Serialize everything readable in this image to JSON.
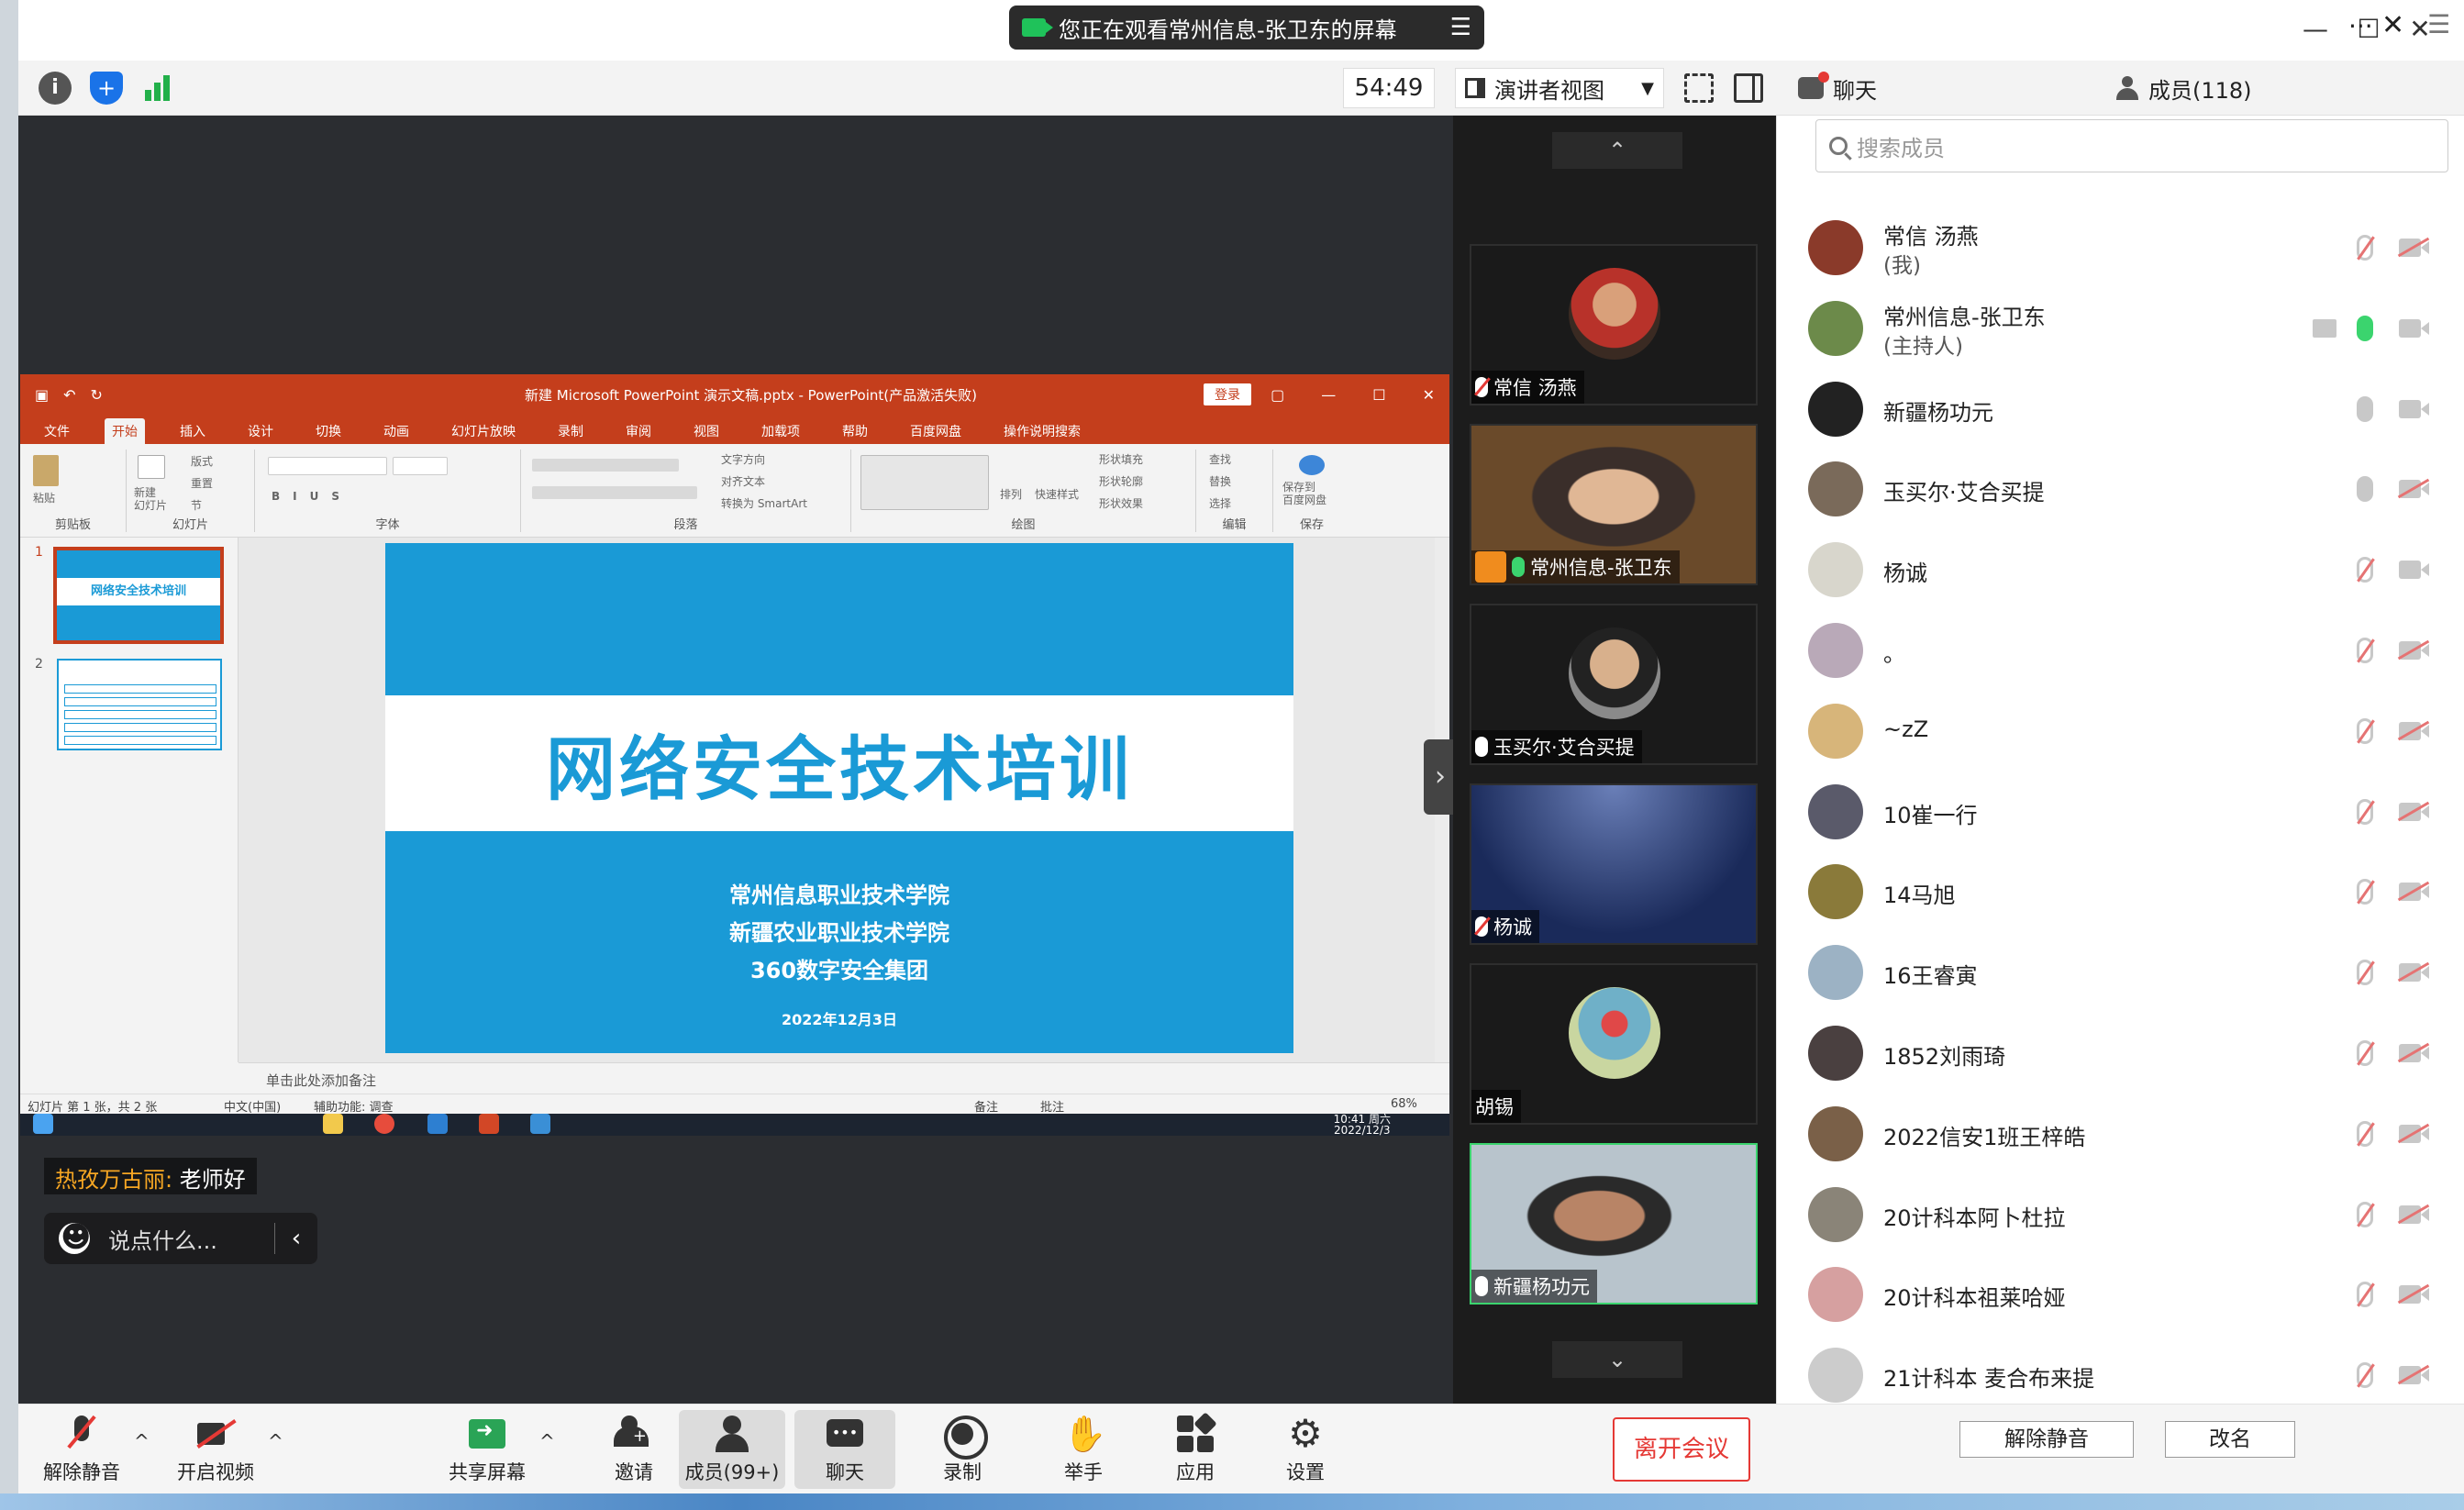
{
  "banner": {
    "text": "您正在观看常州信息-张卫东的屏幕",
    "menu_icon": "menu-icon"
  },
  "window_controls": {
    "minimize": "—",
    "maximize": "☐",
    "close": "✕"
  },
  "toolbar": {
    "timer": "54:49",
    "view_mode": "演讲者视图"
  },
  "ppt": {
    "doc_title": "新建 Microsoft PowerPoint 演示文稿.pptx - PowerPoint(产品激活失败)",
    "login": "登录",
    "tabs": [
      "文件",
      "开始",
      "插入",
      "设计",
      "切换",
      "动画",
      "幻灯片放映",
      "录制",
      "审阅",
      "视图",
      "加载项",
      "帮助",
      "百度网盘",
      "操作说明搜索"
    ],
    "ribbon_groups": [
      "剪贴板",
      "幻灯片",
      "字体",
      "段落",
      "绘图",
      "编辑",
      "保存"
    ],
    "ribbon_labels": {
      "paste": "粘贴",
      "new_slide": "新建\n幻灯片",
      "layout": "版式",
      "reset": "重置",
      "section": "节",
      "text_dir": "文字方向",
      "align_text": "对齐文本",
      "smartart": "转换为 SmartArt",
      "arrange": "排列",
      "quick_style": "快速样式",
      "shape_fill": "形状填充",
      "shape_outline": "形状轮廓",
      "shape_effect": "形状效果",
      "find": "查找",
      "replace": "替换",
      "select": "选择",
      "save_baidu": "保存到\n百度网盘"
    },
    "thumb1_title": "网络安全技术培训",
    "thumb_numbers": [
      "1",
      "2"
    ],
    "slide": {
      "title": "网络安全技术培训",
      "orgs": [
        "常州信息职业技术学院",
        "新疆农业职业技术学院",
        "360数字安全集团"
      ],
      "date": "2022年12月3日"
    },
    "notes_placeholder": "单击此处添加备注",
    "status": {
      "slide_count": "幻灯片 第 1 张，共 2 张",
      "language": "中文(中国)",
      "accessibility": "辅助功能: 调查",
      "notes": "备注",
      "comments": "批注",
      "zoom": "68%"
    },
    "clock": {
      "time": "10:41 周六",
      "date": "2022/12/3"
    }
  },
  "chat_overlay": {
    "sender": "热孜万古丽:",
    "message": "老师好",
    "input_placeholder": "说点什么...",
    "collapse": "‹"
  },
  "video_tiles": [
    {
      "name": "常信 汤燕",
      "mic": "muted"
    },
    {
      "name": "常州信息-张卫东",
      "mic": "active"
    },
    {
      "name": "玉买尔·艾合买提",
      "mic": "on"
    },
    {
      "name": "杨诚",
      "mic": "muted"
    },
    {
      "name": "胡锡",
      "mic": "none"
    },
    {
      "name": "新疆杨功元",
      "mic": "on"
    }
  ],
  "panel": {
    "chat_tab": "聊天",
    "members_tab": "成员(118)",
    "more": "···",
    "close": "✕",
    "search_placeholder": "搜索成员",
    "members": [
      {
        "name": "常信 汤燕",
        "sub": "(我)",
        "mic": "muted",
        "cam": "muted",
        "color": "#8a3a2a"
      },
      {
        "name": "常州信息-张卫东",
        "sub": "(主持人)",
        "mic": "green",
        "cam": "on",
        "share": true,
        "color": "#6c8a4a"
      },
      {
        "name": "新疆杨功元",
        "sub": "",
        "mic": "on",
        "cam": "on",
        "color": "#222222"
      },
      {
        "name": "玉买尔·艾合买提",
        "sub": "",
        "mic": "on",
        "cam": "muted",
        "color": "#7a6a5a"
      },
      {
        "name": "杨诚",
        "sub": "",
        "mic": "muted",
        "cam": "on",
        "color": "#d8d6cc"
      },
      {
        "name": "。",
        "sub": "",
        "mic": "muted",
        "cam": "muted",
        "color": "#b9a9b8"
      },
      {
        "name": "~zZ",
        "sub": "",
        "mic": "muted",
        "cam": "muted",
        "color": "#d7b57a"
      },
      {
        "name": "10崔一行",
        "sub": "",
        "mic": "muted",
        "cam": "muted",
        "color": "#5a5a6a"
      },
      {
        "name": "14马旭",
        "sub": "",
        "mic": "muted",
        "cam": "muted",
        "color": "#8a7a3a"
      },
      {
        "name": "16王睿寅",
        "sub": "",
        "mic": "muted",
        "cam": "muted",
        "color": "#9cb2c4"
      },
      {
        "name": "1852刘雨琦",
        "sub": "",
        "mic": "muted",
        "cam": "muted",
        "color": "#4a4040"
      },
      {
        "name": "2022信安1班王梓皓",
        "sub": "",
        "mic": "muted",
        "cam": "muted",
        "color": "#7a6048"
      },
      {
        "name": "20计科本阿卜杜拉",
        "sub": "",
        "mic": "muted",
        "cam": "muted",
        "color": "#8a8478"
      },
      {
        "name": "20计科本祖莱哈娅",
        "sub": "",
        "mic": "muted",
        "cam": "muted",
        "color": "#d6a0a0"
      },
      {
        "name": "21计科本 麦合布来提",
        "sub": "",
        "mic": "muted",
        "cam": "muted",
        "color": "#cccccc"
      }
    ],
    "unmute_btn": "解除静音",
    "rename_btn": "改名"
  },
  "bottom": {
    "unmute": "解除静音",
    "start_video": "开启视频",
    "share_screen": "共享屏幕",
    "invite": "邀请",
    "members": "成员(99+)",
    "chat": "聊天",
    "record": "录制",
    "raise_hand": "举手",
    "apps": "应用",
    "settings": "设置",
    "leave": "离开会议",
    "caret": "^"
  }
}
